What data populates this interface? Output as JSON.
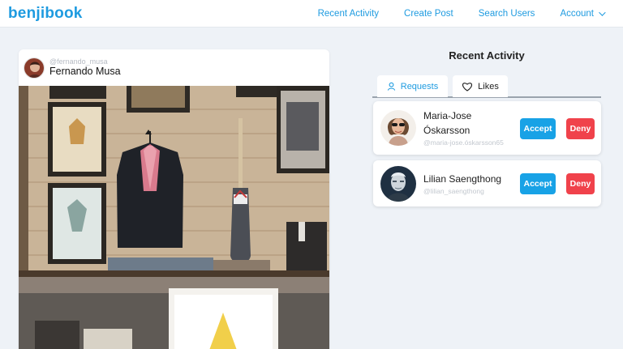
{
  "navbar": {
    "brand": "benjibook",
    "links": {
      "recent_activity": "Recent Activity",
      "create_post": "Create Post",
      "search_users": "Search Users",
      "account": "Account"
    }
  },
  "post": {
    "handle": "@fernando_musa",
    "name": "Fernando Musa"
  },
  "activity": {
    "title": "Recent Activity",
    "tabs": {
      "requests": "Requests",
      "likes": "Likes"
    },
    "requests": [
      {
        "name": "Maria-Jose Óskarsson",
        "handle": "@maria-jose.óskarsson65",
        "accept": "Accept",
        "deny": "Deny"
      },
      {
        "name": "Lilian Saengthong",
        "handle": "@lilian_saengthong",
        "accept": "Accept",
        "deny": "Deny"
      }
    ]
  },
  "colors": {
    "brand": "#1e9be0",
    "accept": "#18a2e6",
    "deny": "#f0424b",
    "background": "#eef2f7"
  }
}
